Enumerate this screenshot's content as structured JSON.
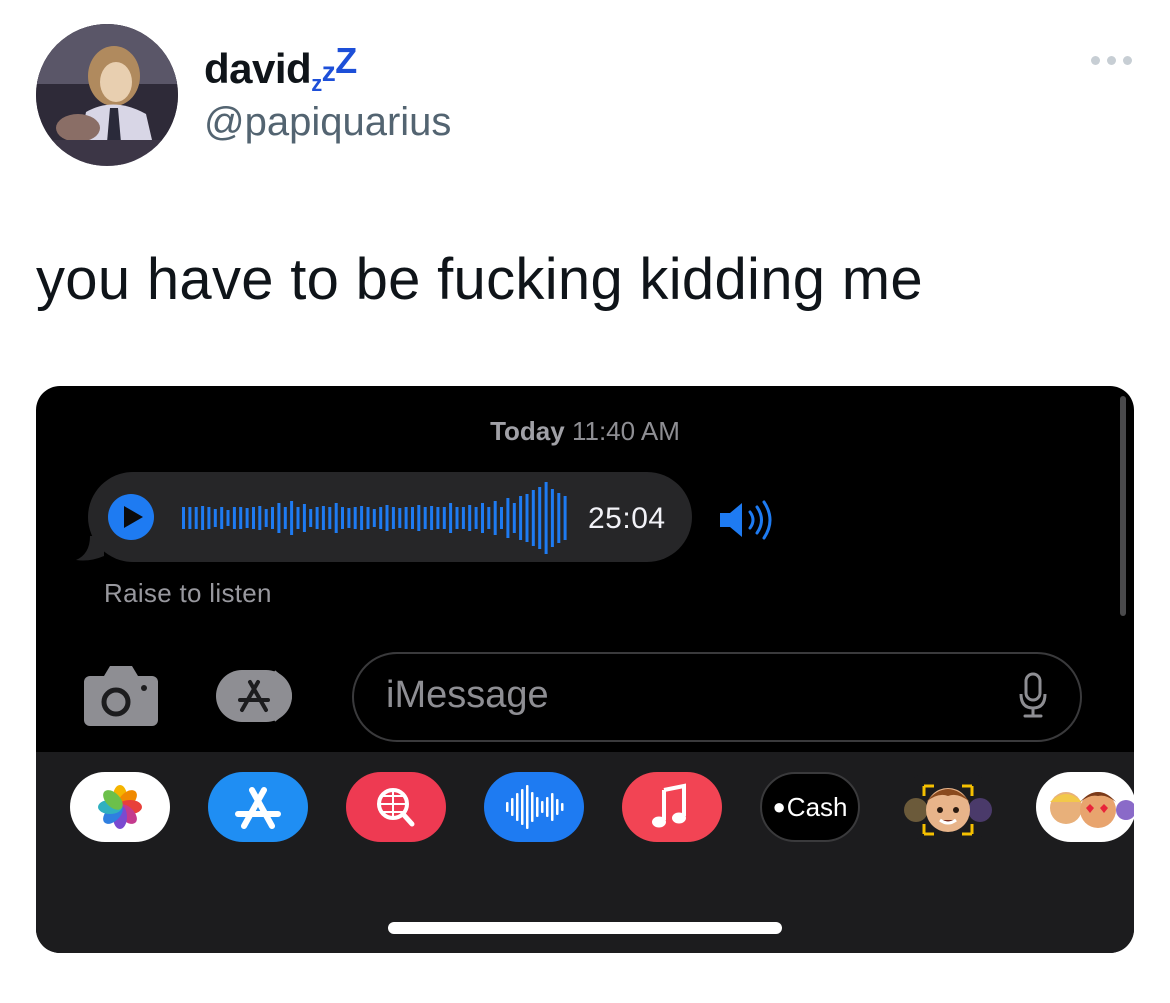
{
  "tweet": {
    "display_name": "david",
    "name_suffix": [
      "z",
      "z",
      "Z"
    ],
    "handle": "@papiquarius",
    "text": "you have to be fucking kidding me"
  },
  "screenshot": {
    "timestamp_day": "Today",
    "timestamp_time": "11:40 AM",
    "audio_message": {
      "duration": "25:04",
      "hint": "Raise to listen"
    },
    "input_placeholder": "iMessage",
    "app_tray": [
      {
        "name": "Photos",
        "icon": "photos-icon"
      },
      {
        "name": "App Store",
        "icon": "app-store-icon"
      },
      {
        "name": "Images Search",
        "icon": "image-search-icon"
      },
      {
        "name": "Audio Message",
        "icon": "audio-waveform-icon"
      },
      {
        "name": "Music",
        "icon": "music-icon"
      },
      {
        "name": "Apple Cash",
        "icon": "apple-cash-icon",
        "label": "Cash"
      },
      {
        "name": "Memoji",
        "icon": "memoji-icon"
      },
      {
        "name": "Memoji Stickers",
        "icon": "memoji-stickers-icon"
      }
    ],
    "colors": {
      "accent_blue": "#1e7bf2",
      "bubble": "#262628",
      "tray": "#1c1c1e"
    }
  }
}
